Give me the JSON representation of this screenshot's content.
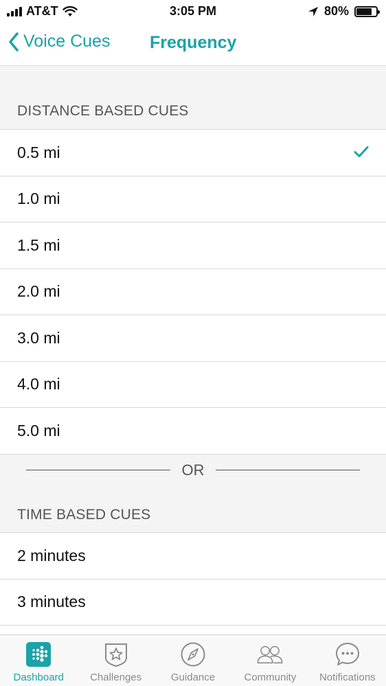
{
  "status_bar": {
    "carrier": "AT&T",
    "time": "3:05 PM",
    "battery": "80%",
    "battery_level": 0.8
  },
  "nav": {
    "back_label": "Voice Cues",
    "title": "Frequency"
  },
  "distance_section": {
    "header": "DISTANCE BASED CUES",
    "options": [
      "0.5 mi",
      "1.0 mi",
      "1.5 mi",
      "2.0 mi",
      "3.0 mi",
      "4.0 mi",
      "5.0 mi"
    ],
    "selected": "0.5 mi"
  },
  "divider": {
    "label": "OR"
  },
  "time_section": {
    "header": "TIME BASED CUES",
    "options": [
      "2 minutes",
      "3 minutes"
    ]
  },
  "tab_bar": {
    "tabs": [
      {
        "label": "Dashboard",
        "icon": "fitbit-dots-icon",
        "active": true
      },
      {
        "label": "Challenges",
        "icon": "star-badge-icon",
        "active": false
      },
      {
        "label": "Guidance",
        "icon": "compass-icon",
        "active": false
      },
      {
        "label": "Community",
        "icon": "people-icon",
        "active": false
      },
      {
        "label": "Notifications",
        "icon": "chat-bubble-icon",
        "active": false
      }
    ]
  },
  "colors": {
    "accent": "#1aa3a8",
    "background": "#f4f4f4",
    "inactive": "#8b8b8b"
  }
}
